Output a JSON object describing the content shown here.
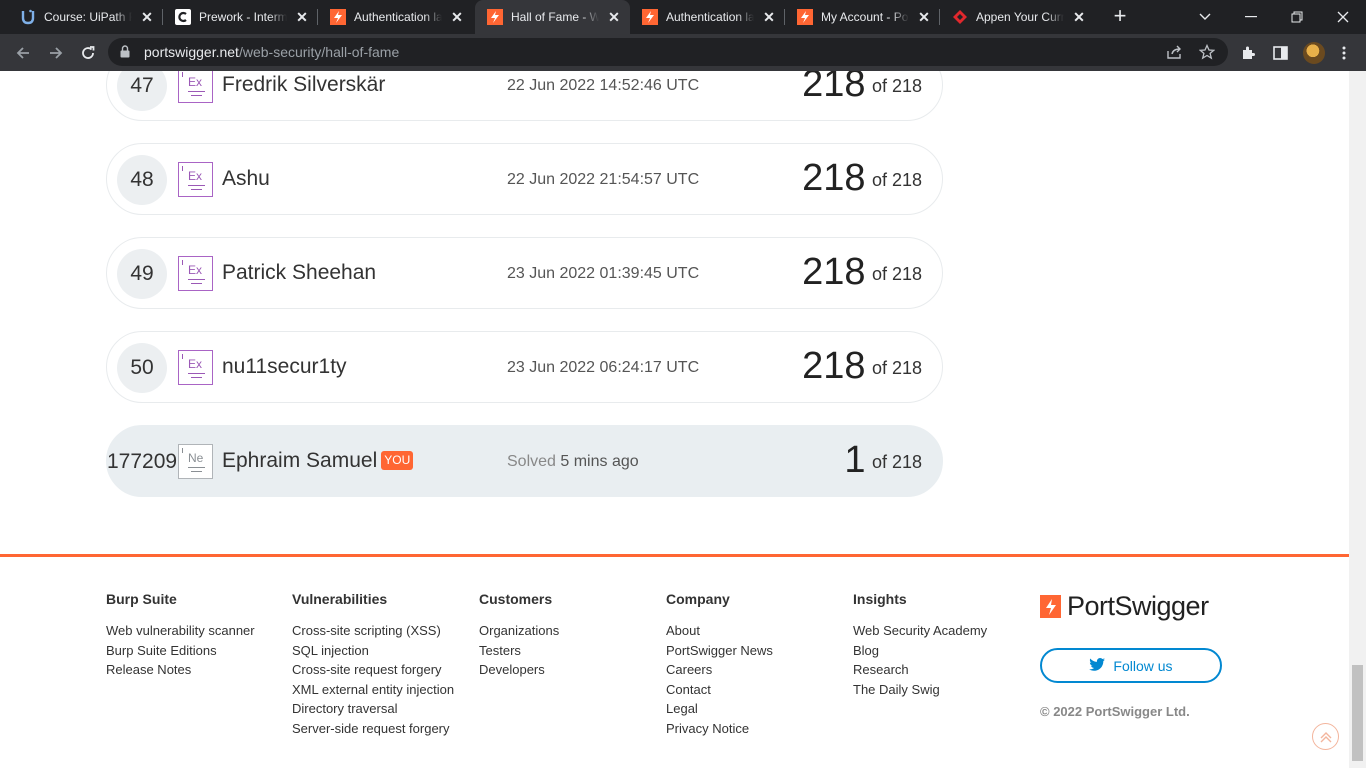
{
  "browser": {
    "tabs": [
      {
        "title": "Course: UiPath RPA",
        "icon": "uipath-icon",
        "active": false
      },
      {
        "title": "Prework - Intermediate",
        "icon": "coursera-icon",
        "active": false
      },
      {
        "title": "Authentication lab",
        "icon": "portswigger-icon",
        "active": false
      },
      {
        "title": "Hall of Fame - Web Security",
        "icon": "portswigger-icon",
        "active": true
      },
      {
        "title": "Authentication lab",
        "icon": "portswigger-icon",
        "active": false
      },
      {
        "title": "My Account - PortSwigger",
        "icon": "portswigger-icon",
        "active": false
      },
      {
        "title": "Appen Your Current",
        "icon": "appen-icon",
        "active": false
      }
    ],
    "url_host": "portswigger.net",
    "url_path": "/web-security/hall-of-fame"
  },
  "leaderboard": {
    "rows": [
      {
        "rank": "47",
        "level": "Ex",
        "name": "Fredrik Silverskär",
        "date": "22 Jun 2022 14:52:46 UTC",
        "solved": "218",
        "of": "of 218"
      },
      {
        "rank": "48",
        "level": "Ex",
        "name": "Ashu",
        "date": "22 Jun 2022 21:54:57 UTC",
        "solved": "218",
        "of": "of 218"
      },
      {
        "rank": "49",
        "level": "Ex",
        "name": "Patrick Sheehan",
        "date": "23 Jun 2022 01:39:45 UTC",
        "solved": "218",
        "of": "of 218"
      },
      {
        "rank": "50",
        "level": "Ex",
        "name": "nu11secur1ty",
        "date": "23 Jun 2022 06:24:17 UTC",
        "solved": "218",
        "of": "of 218"
      }
    ],
    "me": {
      "rank": "177209",
      "level": "Ne",
      "name": "Ephraim Samuel",
      "you_badge": "YOU",
      "solved_label": "Solved",
      "solved_ago": "5 mins ago",
      "solved": "1",
      "of": "of 218"
    }
  },
  "footer": {
    "columns": [
      {
        "heading": "Burp Suite",
        "links": [
          "Web vulnerability scanner",
          "Burp Suite Editions",
          "Release Notes"
        ]
      },
      {
        "heading": "Vulnerabilities",
        "links": [
          "Cross-site scripting (XSS)",
          "SQL injection",
          "Cross-site request forgery",
          "XML external entity injection",
          "Directory traversal",
          "Server-side request forgery"
        ]
      },
      {
        "heading": "Customers",
        "links": [
          "Organizations",
          "Testers",
          "Developers"
        ]
      },
      {
        "heading": "Company",
        "links": [
          "About",
          "PortSwigger News",
          "Careers",
          "Contact",
          "Legal",
          "Privacy Notice"
        ]
      },
      {
        "heading": "Insights",
        "links": [
          "Web Security Academy",
          "Blog",
          "Research",
          "The Daily Swig"
        ]
      }
    ],
    "brand": "PortSwigger",
    "follow_label": "Follow us",
    "copyright": "© 2022 PortSwigger Ltd."
  },
  "colors": {
    "accent": "#ff6633",
    "twitter": "#0288d1",
    "badge_expert": "#9b59b6"
  }
}
